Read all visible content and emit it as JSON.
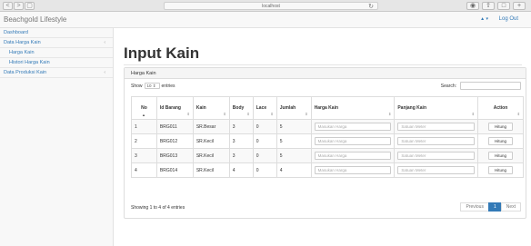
{
  "browser": {
    "address": "localhost",
    "nav_back": "<",
    "nav_forward": ">"
  },
  "topbar": {
    "brand": "Beachgold Lifestyle",
    "user_menu": "▲ ▾",
    "logout": "Log Out"
  },
  "sidebar": {
    "items": [
      {
        "label": "Dashboard"
      },
      {
        "label": "Data Harga Kain",
        "arrow": "‹"
      },
      {
        "label": "Harga Kain"
      },
      {
        "label": "Histori Harga Kain"
      },
      {
        "label": "Data Produksi Kain",
        "arrow": "‹"
      }
    ]
  },
  "main": {
    "title": "Input Kain",
    "panel_title": "Harga Kain",
    "show_label": "Show",
    "entries_value": "10",
    "entries_label": "entries",
    "search_label": "Search:",
    "columns": [
      "No",
      "Id Barang",
      "Kain",
      "Body",
      "Lace",
      "Jumlah",
      "Harga Kain",
      "Panjang Kain",
      "Action"
    ],
    "rows": [
      {
        "no": "1",
        "id": "BRG011",
        "kain": "SR.Besar",
        "body": "3",
        "lace": "0",
        "jumlah": "5"
      },
      {
        "no": "2",
        "id": "BRG012",
        "kain": "SR.Kecil",
        "body": "3",
        "lace": "0",
        "jumlah": "5"
      },
      {
        "no": "3",
        "id": "BRG013",
        "kain": "SR.Kecil",
        "body": "3",
        "lace": "0",
        "jumlah": "5"
      },
      {
        "no": "4",
        "id": "BRG014",
        "kain": "SR.Kecil",
        "body": "4",
        "lace": "0",
        "jumlah": "4"
      }
    ],
    "harga_placeholder": "Masukan Harga",
    "panjang_placeholder": "Satuan Meter",
    "action_label": "Hitung",
    "info": "Showing 1 to 4 of 4 entries",
    "pager": {
      "prev": "Previous",
      "page": "1",
      "next": "Next"
    }
  },
  "colors": {
    "accent": "#337ab7",
    "sidebar_bg": "#f8f8f8"
  }
}
